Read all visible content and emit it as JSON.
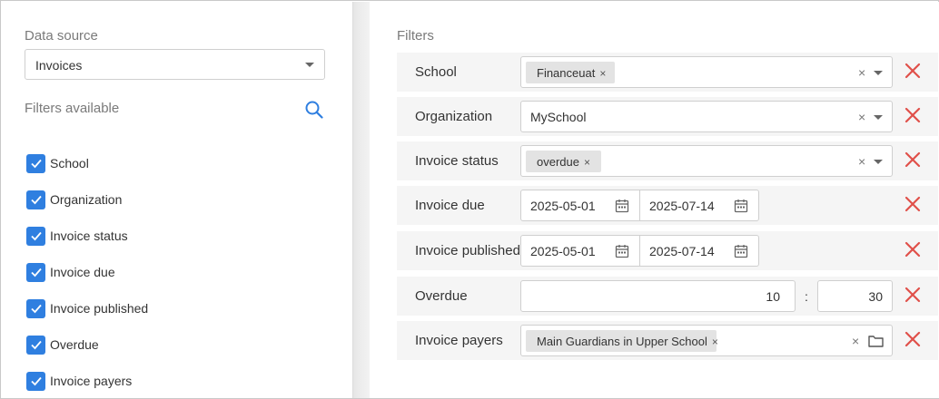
{
  "left": {
    "data_source_label": "Data source",
    "data_source_value": "Invoices",
    "filters_available_label": "Filters available",
    "checkboxes": [
      {
        "label": "School",
        "checked": true
      },
      {
        "label": "Organization",
        "checked": true
      },
      {
        "label": "Invoice status",
        "checked": true
      },
      {
        "label": "Invoice due",
        "checked": true
      },
      {
        "label": "Invoice published",
        "checked": true
      },
      {
        "label": "Overdue",
        "checked": true
      },
      {
        "label": "Invoice payers",
        "checked": true
      }
    ]
  },
  "right": {
    "title": "Filters",
    "filters": {
      "school": {
        "label": "School",
        "tag": "Financeuat",
        "tag_x": "×",
        "clear": "×"
      },
      "organization": {
        "label": "Organization",
        "value": "MySchool",
        "clear": "×"
      },
      "invoice_status": {
        "label": "Invoice status",
        "tag": "overdue",
        "tag_x": "×",
        "clear": "×"
      },
      "invoice_due": {
        "label": "Invoice due",
        "from": "2025-05-01",
        "to": "2025-07-14"
      },
      "invoice_published": {
        "label": "Invoice published",
        "from": "2025-05-01",
        "to": "2025-07-14"
      },
      "overdue": {
        "label": "Overdue",
        "min": "10",
        "separator": ":",
        "max": "30"
      },
      "invoice_payers": {
        "label": "Invoice payers",
        "tag": "Main Guardians in Upper School",
        "tag_x": "×",
        "clear": "×"
      }
    }
  },
  "colors": {
    "accent": "#2f7fe0",
    "remove": "#e0504a",
    "row_bg": "#f5f5f5"
  },
  "icons": [
    "search-icon",
    "chevron-down-icon",
    "check-icon",
    "calendar-icon",
    "folder-icon",
    "remove-icon"
  ]
}
